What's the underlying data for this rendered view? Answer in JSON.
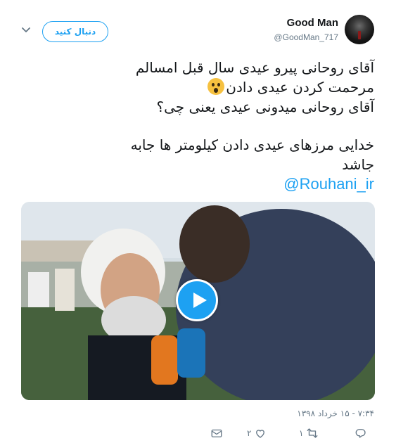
{
  "header": {
    "display_name": "Good Man",
    "handle": "@GoodMan_717",
    "follow_label": "دنبال کنید"
  },
  "tweet": {
    "lines": [
      "آقای روحانی پیرو عیدی سال قبل امسالم",
      "مرحمت کردن عیدی دادن",
      "آقای روحانی میدونی عیدی یعنی چی؟",
      "خدایی مرزهای عیدی دادن کیلومتر ها جابه",
      "جاشد"
    ],
    "mention": "@Rouhani_ir"
  },
  "media": {
    "type": "video"
  },
  "timestamp": "۷:۳۴ - ۱۵ خرداد ۱۳۹۸",
  "actions": {
    "reply_count": "",
    "retweet_count": "۱",
    "like_count": "۲"
  },
  "colors": {
    "accent": "#1da1f2",
    "secondary_text": "#657786",
    "text": "#14171a"
  },
  "icons": [
    "chevron-down-icon",
    "play-icon",
    "reply-icon",
    "retweet-icon",
    "heart-icon",
    "envelope-icon"
  ]
}
